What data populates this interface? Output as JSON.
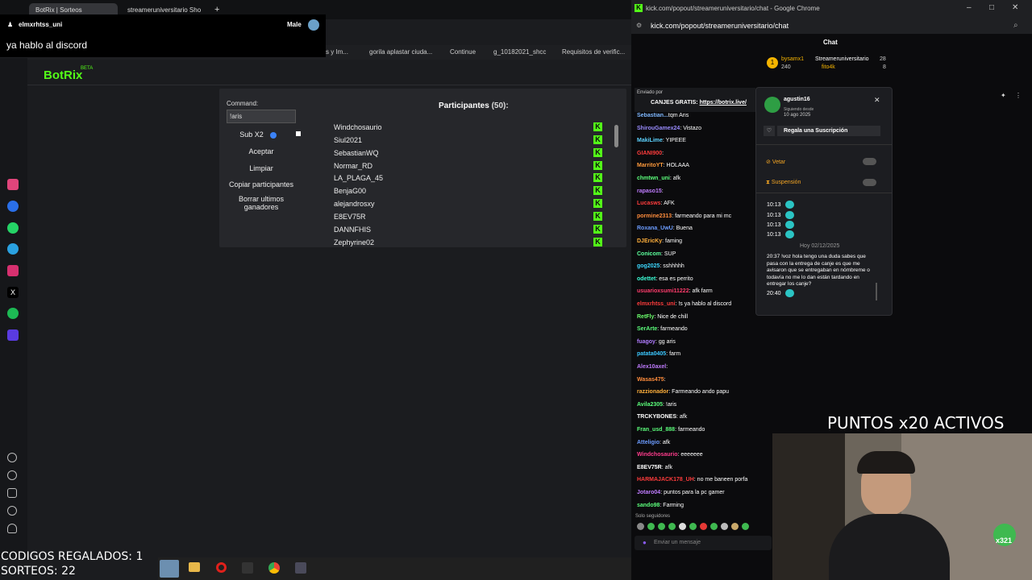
{
  "browser": {
    "tab1": "BotRix | Sorteos",
    "tab2": "streameruniversitario Sho",
    "bookmarks": [
      "s y Im...",
      "gorila aplastar ciuda...",
      "Continue",
      "g_10182021_shcc",
      "Requisitos de verific..."
    ]
  },
  "notification": {
    "user": "elmxrhtss_uni",
    "gender": "Male",
    "text": "ya hablo al discord"
  },
  "botrix": {
    "logo": "BotRix",
    "beta": "BETA",
    "command_label": "Command:",
    "command_value": "!aris",
    "sub_label": "Sub X2",
    "accept": "Aceptar",
    "clear": "Limpiar",
    "copy": "Copiar participantes",
    "delete_winners": "Borrar ultimos ganadores",
    "participants_title": "Participantes",
    "participants_count": "(50):",
    "participants": [
      "Windchosaurio",
      "Siul2021",
      "SebastianWQ",
      "Normar_RD",
      "LA_PLAGA_45",
      "BenjaG00",
      "alejandrosxy",
      "E8EV75R",
      "DANNFHIS",
      "Zephyrine02"
    ]
  },
  "chat_window": {
    "title": "kick.com/popout/streameruniversitario/chat - Google Chrome",
    "url": "kick.com/popout/streameruniversitario/chat",
    "header": "Chat",
    "leaderboard": [
      {
        "name": "bysamx1",
        "val": "240"
      },
      {
        "name": "Streameruniversitario",
        "val": "28"
      },
      {
        "name": "fito4k",
        "val": "8"
      }
    ],
    "pinned": {
      "by": "Enviado por",
      "text": "CANJES GRATIS:",
      "link": "https://botrix.live/"
    },
    "messages": [
      {
        "u": "Sebastian...",
        "t": "tqm Aris",
        "c": "#7fb8ff"
      },
      {
        "u": "ShirouGamex24",
        "t": ": Vistazo",
        "c": "#9a8cff"
      },
      {
        "u": "MakiLime",
        "t": ": YIPEEE",
        "c": "#5dd3ff"
      },
      {
        "u": "GIANI900",
        "t": ":",
        "c": "#ff3c3c"
      },
      {
        "u": "MarritoYT",
        "t": ": HOLAAA",
        "c": "#ff9a3c"
      },
      {
        "u": "chmtwn_uni",
        "t": ": afk",
        "c": "#5cff7c"
      },
      {
        "u": "rapaso15",
        "t": ":",
        "c": "#c07cff"
      },
      {
        "u": "Lucasws",
        "t": ": AFK",
        "c": "#ff3c3c"
      },
      {
        "u": "pormine2313",
        "t": ": farmeando para mi mc",
        "c": "#ff8c3c"
      },
      {
        "u": "Roxana_UwU",
        "t": ": Buena",
        "c": "#6c9cff"
      },
      {
        "u": "DJEricKy",
        "t": ": faming",
        "c": "#ffb03c"
      },
      {
        "u": "Conicom",
        "t": ": SUP",
        "c": "#5cff9c"
      },
      {
        "u": "gog2025",
        "t": ": sshhhhh",
        "c": "#3cd8ff"
      },
      {
        "u": "odettet",
        "t": ": esa es perrito",
        "c": "#3cffd8"
      },
      {
        "u": "usuarioxsumi11222",
        "t": ": afk farm",
        "c": "#ff3c6c"
      },
      {
        "u": "elmxrhtss_uni",
        "t": ": !s ya hablo al discord",
        "c": "#ff3c3c"
      },
      {
        "u": "RetFly",
        "t": ": Nice de chill",
        "c": "#6cff6c"
      },
      {
        "u": "SerArte",
        "t": ": farmeando",
        "c": "#5cff7c"
      },
      {
        "u": "fuagoy",
        "t": ": gg aris",
        "c": "#b07cff"
      },
      {
        "u": "patata0405",
        "t": ": farm",
        "c": "#3cc8ff"
      },
      {
        "u": "Alex10axel",
        "t": ":",
        "c": "#c07cff"
      },
      {
        "u": "Wasas475",
        "t": ":",
        "c": "#ff8c3c"
      },
      {
        "u": "razzionador",
        "t": ": Farmeando ando papu",
        "c": "#ffb03c"
      },
      {
        "u": "Avila2305",
        "t": ": !aris",
        "c": "#5cff7c"
      },
      {
        "u": "TRCKYBONES",
        "t": ": afk",
        "c": "#ffffff"
      },
      {
        "u": "Fran_usd_888",
        "t": ": farmeando",
        "c": "#5cff7c"
      },
      {
        "u": "Atteligio",
        "t": ": afk",
        "c": "#6c9cff"
      },
      {
        "u": "Windchosaurio",
        "t": ": eeeeeee",
        "c": "#ff3c8c"
      },
      {
        "u": "E8EV75R",
        "t": ": afk",
        "c": "#ffffff"
      },
      {
        "u": "HARMAJACK178_UH",
        "t": ": no me baneen porfa",
        "c": "#ff3c3c"
      },
      {
        "u": "Jotaro04",
        "t": ": puntos para la pc gamer",
        "c": "#c07cff"
      },
      {
        "u": "sando98",
        "t": ": Farming",
        "c": "#5cff7c"
      }
    ],
    "followers_only": "Solo seguidores",
    "input_placeholder": "Enviar un mensaje"
  },
  "popup": {
    "user": "agustin16",
    "following": "Siguiendo desde",
    "date": "10 ago 2025",
    "gift": "Regala una Suscripción",
    "veto": "Vetar",
    "suspend": "Suspensión",
    "times": [
      "10:13",
      "10:13",
      "10:13",
      "10:13"
    ],
    "divider": "Hoy 02/12/2025",
    "msg_time": "20:37",
    "msg": "!voz hola tengo una duda sabes que pasa con la entrega de canje es que me avisaron que se entregaban en nómbreme o todavía no me lo dan están tardando en entregar los canje?",
    "last_time": "20:40"
  },
  "overlay": {
    "points": "PUNTOS x20 ACTIVOS",
    "codes": "CODIGOS REGALADOS: 1",
    "raffles": "SORTEOS: 22",
    "badge": "x321"
  }
}
